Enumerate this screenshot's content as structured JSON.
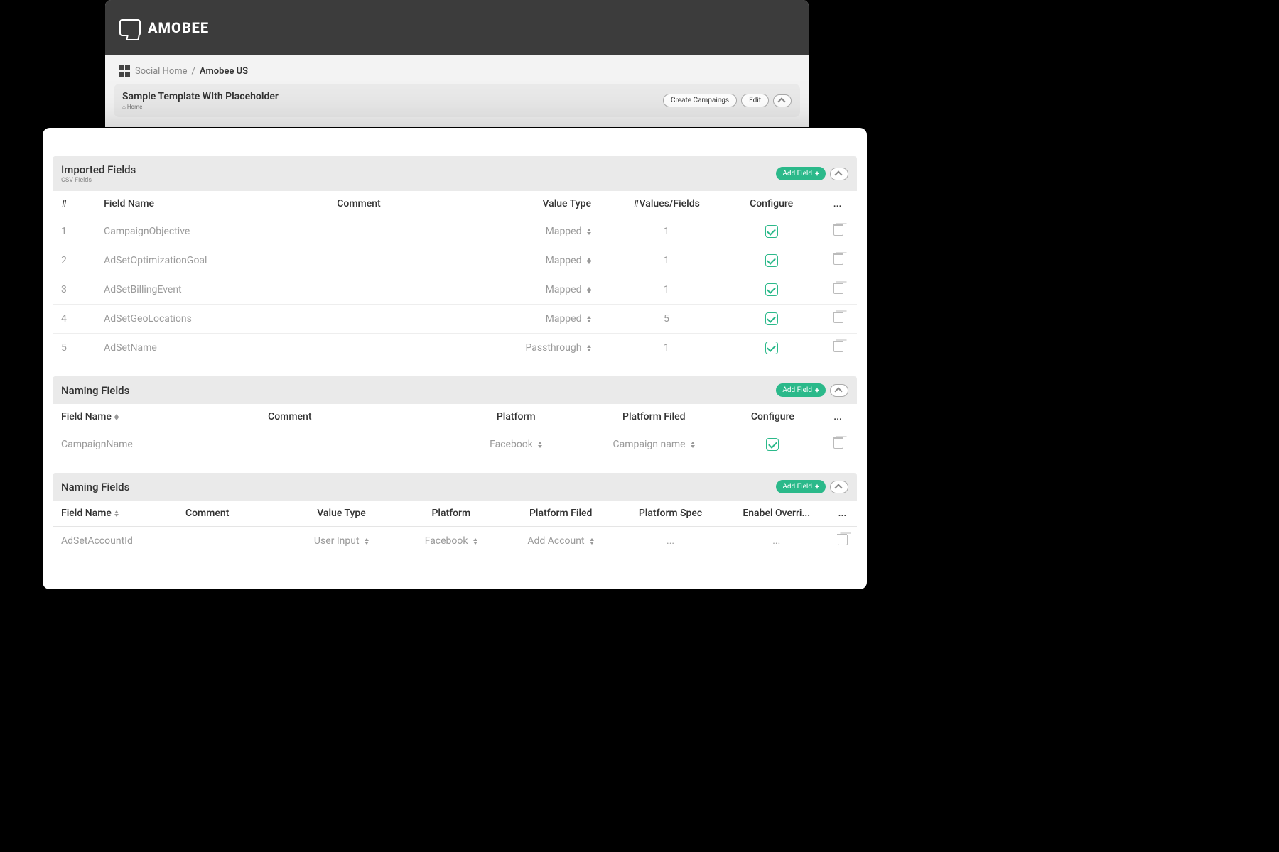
{
  "brand": "AMOBEE",
  "breadcrumb": {
    "home": "Social Home",
    "sep": "/",
    "current": "Amobee US"
  },
  "page": {
    "title": "Sample Template WIth Placeholder",
    "sub_icon": "⌂",
    "sub": "Home",
    "create_btn": "Create Campaings",
    "edit_btn": "Edit"
  },
  "sections": {
    "imported": {
      "title": "Imported Fields",
      "sub": "CSV Fields",
      "add": "Add Field",
      "cols": {
        "num": "#",
        "name": "Field Name",
        "comment": "Comment",
        "vt": "Value Type",
        "vals": "#Values/Fields",
        "conf": "Configure",
        "act": "..."
      },
      "rows": [
        {
          "n": "1",
          "name": "CampaignObjective",
          "vt": "Mapped",
          "vals": "1"
        },
        {
          "n": "2",
          "name": "AdSetOptimizationGoal",
          "vt": "Mapped",
          "vals": "1"
        },
        {
          "n": "3",
          "name": "AdSetBillingEvent",
          "vt": "Mapped",
          "vals": "1"
        },
        {
          "n": "4",
          "name": "AdSetGeoLocations",
          "vt": "Mapped",
          "vals": "5"
        },
        {
          "n": "5",
          "name": "AdSetName",
          "vt": "Passthrough",
          "vals": "1"
        }
      ]
    },
    "naming1": {
      "title": "Naming Fields",
      "add": "Add Field",
      "cols": {
        "name": "Field Name",
        "comment": "Comment",
        "plat": "Platform",
        "pf": "Platform Filed",
        "conf": "Configure",
        "act": "..."
      },
      "rows": [
        {
          "name": "CampaignName",
          "plat": "Facebook",
          "pf": "Campaign name"
        }
      ]
    },
    "naming2": {
      "title": "Naming Fields",
      "add": "Add Field",
      "cols": {
        "name": "Field Name",
        "comment": "Comment",
        "vt": "Value Type",
        "plat": "Platform",
        "pf": "Platform Filed",
        "ps": "Platform Spec",
        "eo": "Enabel Overri...",
        "act": "..."
      },
      "rows": [
        {
          "name": "AdSetAccountId",
          "vt": "User Input",
          "plat": "Facebook",
          "pf": "Add Account",
          "ps": "...",
          "eo": "..."
        }
      ]
    }
  }
}
